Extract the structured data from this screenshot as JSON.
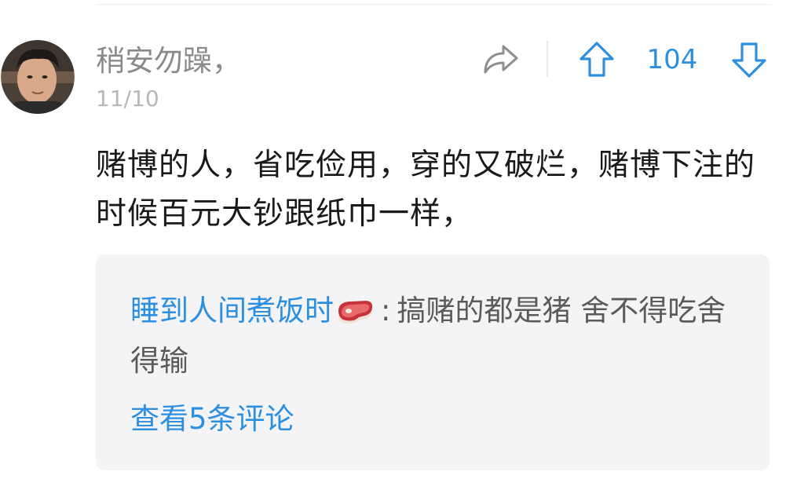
{
  "comment": {
    "author": "稍安勿躁，",
    "date": "11/10",
    "text": "赌博的人，省吃俭用，穿的又破烂，赌博下注的时候百元大钞跟纸巾一样，",
    "votes": {
      "count": "104"
    },
    "icons": {
      "share": "share-arrow-icon",
      "upvote": "arrow-up-icon",
      "downvote": "arrow-down-icon"
    }
  },
  "reply_preview": {
    "author": "睡到人间煮饭时",
    "author_emoji": "steak-icon",
    "separator": ":",
    "text": "搞赌的都是猪 舍不得吃舍得输",
    "view_more_label": "查看5条评论"
  },
  "colors": {
    "accent": "#2c8fe0",
    "username": "#8a8a8a",
    "timestamp": "#b8b8b8",
    "body_text": "#1a1a1a",
    "reply_bg": "#f4f4f6"
  }
}
